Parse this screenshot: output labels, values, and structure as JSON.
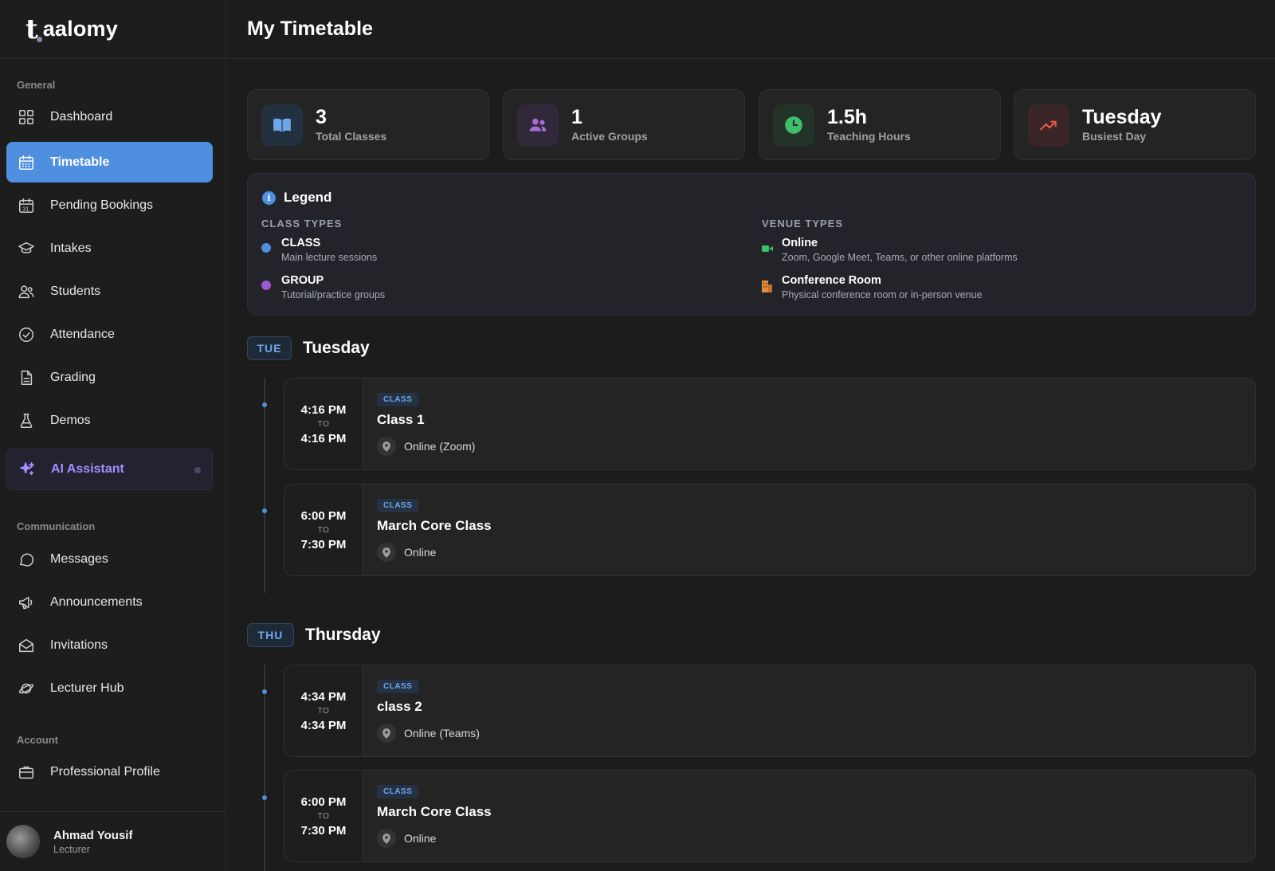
{
  "app": {
    "logo_mark": "t",
    "logo_word": "aalomy"
  },
  "header": {
    "title": "My Timetable"
  },
  "sidebar": {
    "sections": {
      "general": "General",
      "communication": "Communication",
      "account": "Account"
    },
    "items": [
      {
        "label": "Dashboard",
        "icon": "grid-icon"
      },
      {
        "label": "Timetable",
        "icon": "calendar-icon",
        "active": true
      },
      {
        "label": "Pending Bookings",
        "icon": "calendar-31-icon"
      },
      {
        "label": "Intakes",
        "icon": "graduation-cap-icon"
      },
      {
        "label": "Students",
        "icon": "users-icon"
      },
      {
        "label": "Attendance",
        "icon": "check-circle-icon"
      },
      {
        "label": "Grading",
        "icon": "document-icon"
      },
      {
        "label": "Demos",
        "icon": "flask-icon"
      },
      {
        "label": "AI Assistant",
        "icon": "sparkles-icon"
      },
      {
        "label": "Messages",
        "icon": "chat-bubble-icon"
      },
      {
        "label": "Announcements",
        "icon": "megaphone-icon"
      },
      {
        "label": "Invitations",
        "icon": "envelope-open-icon"
      },
      {
        "label": "Lecturer Hub",
        "icon": "planet-icon"
      },
      {
        "label": "Professional Profile",
        "icon": "briefcase-icon"
      }
    ]
  },
  "user": {
    "name": "Ahmad Yousif",
    "role": "Lecturer"
  },
  "stats": [
    {
      "value": "3",
      "label": "Total Classes",
      "icon": "book-open-icon",
      "color": "#4e8fe0"
    },
    {
      "value": "1",
      "label": "Active Groups",
      "icon": "users-icon",
      "color": "#9b59d0"
    },
    {
      "value": "1.5h",
      "label": "Teaching Hours",
      "icon": "clock-icon",
      "color": "#3fbf6a"
    },
    {
      "value": "Tuesday",
      "label": "Busiest Day",
      "icon": "trending-up-icon",
      "color": "#e0584a"
    }
  ],
  "legend": {
    "title": "Legend",
    "class_types_heading": "CLASS TYPES",
    "venue_types_heading": "VENUE TYPES",
    "class_types": [
      {
        "name": "CLASS",
        "desc": "Main lecture sessions",
        "color": "#4e8fe0"
      },
      {
        "name": "GROUP",
        "desc": "Tutorial/practice groups",
        "color": "#9b59d0"
      }
    ],
    "venue_types": [
      {
        "name": "Online",
        "desc": "Zoom, Google Meet, Teams, or other online platforms",
        "icon": "video-camera-icon",
        "color": "#3fbf6a"
      },
      {
        "name": "Conference Room",
        "desc": "Physical conference room or in-person venue",
        "icon": "building-icon",
        "color": "#e08a3a"
      }
    ]
  },
  "days": [
    {
      "badge": "TUE",
      "name": "Tuesday",
      "sessions": [
        {
          "start": "4:16 PM",
          "to": "TO",
          "end": "4:16 PM",
          "tag": "CLASS",
          "title": "Class 1",
          "venue": "Online (Zoom)"
        },
        {
          "start": "6:00 PM",
          "to": "TO",
          "end": "7:30 PM",
          "tag": "CLASS",
          "title": "March Core Class",
          "venue": "Online"
        }
      ]
    },
    {
      "badge": "THU",
      "name": "Thursday",
      "sessions": [
        {
          "start": "4:34 PM",
          "to": "TO",
          "end": "4:34 PM",
          "tag": "CLASS",
          "title": "class 2",
          "venue": "Online (Teams)"
        },
        {
          "start": "6:00 PM",
          "to": "TO",
          "end": "7:30 PM",
          "tag": "CLASS",
          "title": "March Core Class",
          "venue": "Online"
        }
      ]
    }
  ]
}
